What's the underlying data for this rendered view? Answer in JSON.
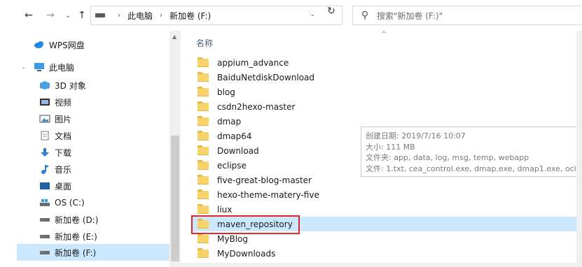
{
  "toolbar": {
    "back_glyph": "←",
    "forward_glyph": "→",
    "recent_glyph": "⌄",
    "up_glyph": "↑",
    "refresh_glyph": "↻",
    "breadcrumb": [
      "此电脑",
      "新加卷 (F:)"
    ],
    "search_placeholder": "搜索\"新加卷 (F:)\""
  },
  "nav": {
    "items": [
      {
        "label": "WPS网盘",
        "icon": "cloud-icon"
      },
      {
        "label": "此电脑",
        "icon": "computer-icon"
      },
      {
        "label": "3D 对象",
        "icon": "3d-objects-icon"
      },
      {
        "label": "视频",
        "icon": "video-icon"
      },
      {
        "label": "图片",
        "icon": "pictures-icon"
      },
      {
        "label": "文档",
        "icon": "documents-icon"
      },
      {
        "label": "下载",
        "icon": "download-icon"
      },
      {
        "label": "音乐",
        "icon": "music-icon"
      },
      {
        "label": "桌面",
        "icon": "desktop-icon"
      },
      {
        "label": "OS (C:)",
        "icon": "drive-icon"
      },
      {
        "label": "新加卷 (D:)",
        "icon": "drive-icon"
      },
      {
        "label": "新加卷 (E:)",
        "icon": "drive-icon"
      },
      {
        "label": "新加卷 (F:)",
        "icon": "drive-icon"
      }
    ]
  },
  "list": {
    "column_name": "名称",
    "files": [
      "appium_advance",
      "BaiduNetdiskDownload",
      "blog",
      "csdn2hexo-master",
      "dmap",
      "dmap64",
      "Download",
      "eclipse",
      "five-great-blog-master",
      "hexo-theme-matery-five",
      "liux",
      "maven_repository",
      "MyBlog",
      "MyDownloads"
    ],
    "selected": "maven_repository"
  },
  "tooltip": {
    "created": "创建日期: 2019/7/16 10:07",
    "size": "大小: 111 MB",
    "folders": "文件夹: app, data, log, msg, temp, webapp",
    "files": "文件: 1.txt, cea_control.exe, dmap.exe, dmap1.exe, oci"
  },
  "colors": {
    "selection": "#cce8ff",
    "highlight_border": "#e0262a",
    "folder": "#f7d36c"
  }
}
